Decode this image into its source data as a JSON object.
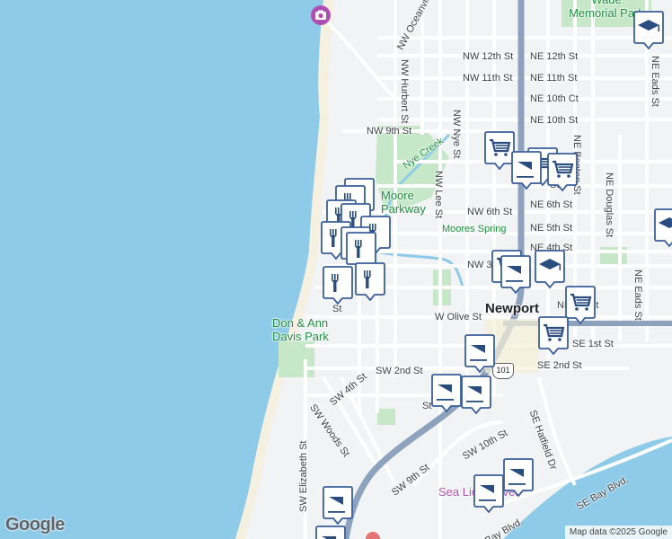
{
  "map": {
    "attribution": "Map data ©2025 Google",
    "logo": "Google",
    "city_label": "Newport",
    "colors": {
      "water": "#8ecbe8",
      "beach": "#f6f0e0",
      "land": "#f1f3f4",
      "road": "#ffffff",
      "highway": "#8da2bd",
      "park": "#c6e8c9",
      "pin_fill": "#ffffff",
      "pin_stroke": "#3a5f9a",
      "pin_icon": "#2a4d80"
    },
    "street_labels": [
      "NW Oceanview Dr",
      "NE 12th St",
      "NW 12th St",
      "NE 11th St",
      "NW 11th St",
      "NE 10th Ct",
      "NE 10th St",
      "NW 9th St",
      "NW 6th St",
      "NE 6th St",
      "NE 5th St",
      "NE 4th St",
      "NW 3rd St",
      "NE 1st St",
      "W Olive St",
      "SE 1st St",
      "SE 2nd St",
      "SW 2nd St",
      "SW 4th St",
      "SW Woods St",
      "SW Elizabeth St",
      "SW 10th St",
      "SW 9th St",
      "SE Bay Blvd.",
      "SE Hatfield Dr",
      "NW Hurbert St",
      "NW Nye St",
      "NW Lee St",
      "NE Benton St",
      "NE Douglas St",
      "NE Eads St",
      "NE Eads St",
      "Bay Blvd.",
      "St",
      "St",
      "St"
    ],
    "parks": [
      "Don & Ann Davis Park",
      "Moore Parkway",
      "Wade Memorial Park",
      "Nye Creek",
      "Moores Spring"
    ],
    "pois": [
      "Sea Lion Caves"
    ],
    "highway_shield": "101",
    "pins": [
      {
        "icon": "graduation-cap-icon"
      },
      {
        "icon": "graduation-cap-icon"
      },
      {
        "icon": "graduation-cap-icon"
      },
      {
        "icon": "shopping-cart-icon"
      },
      {
        "icon": "shopping-cart-icon"
      },
      {
        "icon": "shopping-cart-icon"
      },
      {
        "icon": "shopping-cart-icon"
      },
      {
        "icon": "shopping-cart-icon"
      },
      {
        "icon": "coffee-cup-icon"
      },
      {
        "icon": "coffee-cup-icon"
      },
      {
        "icon": "coffee-cup-icon"
      },
      {
        "icon": "coffee-cup-icon"
      },
      {
        "icon": "coffee-cup-icon"
      },
      {
        "icon": "coffee-cup-icon"
      },
      {
        "icon": "coffee-cup-icon"
      },
      {
        "icon": "coffee-cup-icon"
      },
      {
        "icon": "coffee-cup-icon"
      },
      {
        "icon": "restaurant-icon"
      },
      {
        "icon": "restaurant-icon"
      },
      {
        "icon": "restaurant-icon"
      },
      {
        "icon": "restaurant-icon"
      },
      {
        "icon": "restaurant-icon"
      },
      {
        "icon": "restaurant-icon"
      },
      {
        "icon": "restaurant-icon"
      },
      {
        "icon": "restaurant-icon"
      },
      {
        "icon": "restaurant-icon"
      },
      {
        "icon": "restaurant-icon"
      },
      {
        "icon": "shopping-cart-icon"
      }
    ]
  }
}
